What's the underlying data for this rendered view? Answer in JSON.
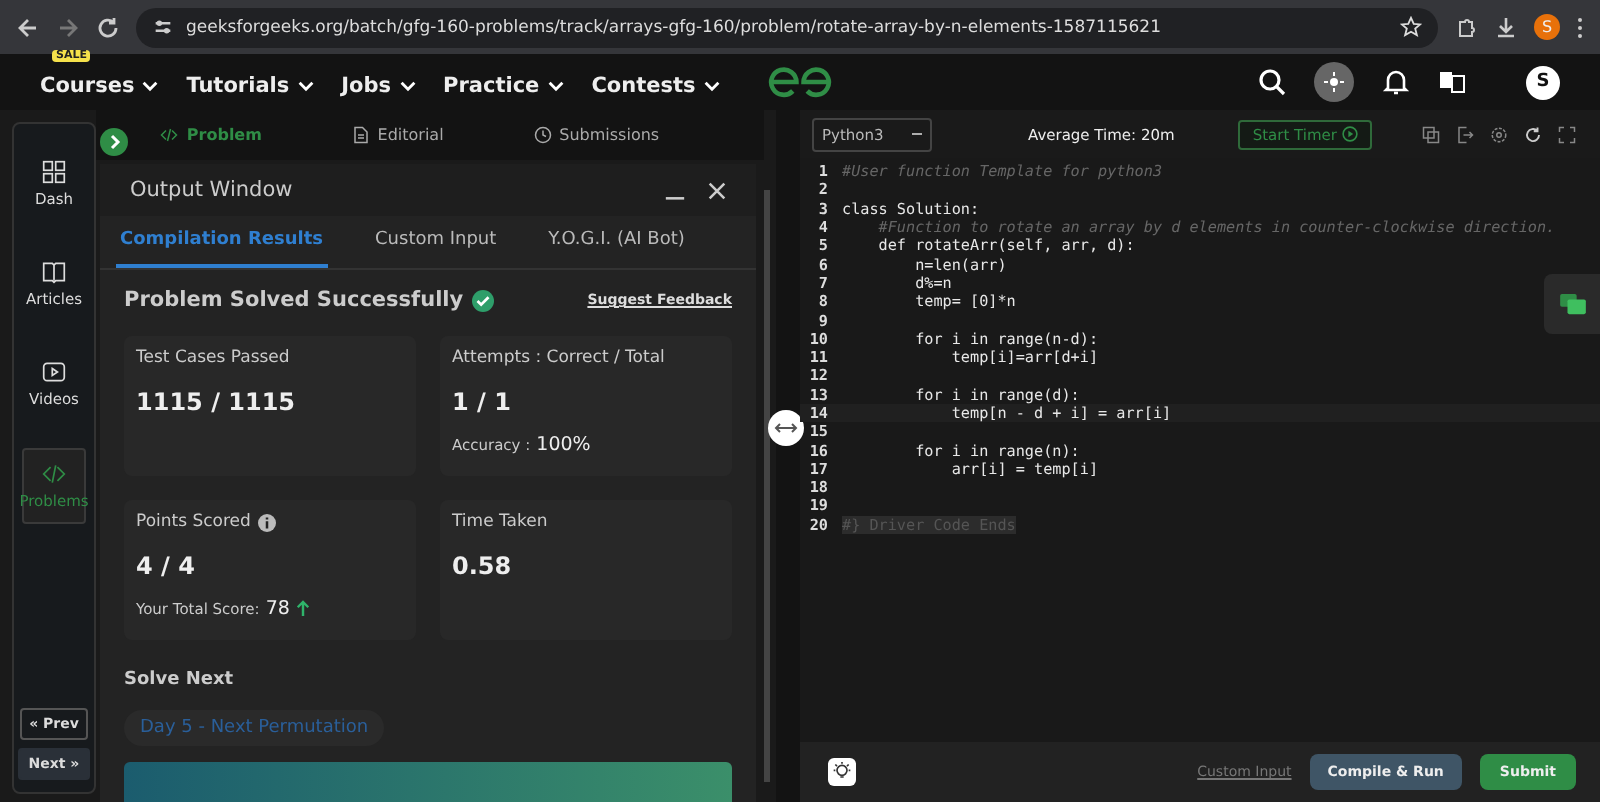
{
  "browser": {
    "url": "geeksforgeeks.org/batch/gfg-160-problems/track/arrays-gfg-160/problem/rotate-array-by-n-elements-1587115621",
    "profile": "S"
  },
  "nav": {
    "items": [
      {
        "label": "Courses",
        "badge": "SALE"
      },
      {
        "label": "Tutorials"
      },
      {
        "label": "Jobs"
      },
      {
        "label": "Practice"
      },
      {
        "label": "Contests"
      }
    ],
    "avatar": "S"
  },
  "sidebar": {
    "items": [
      {
        "label": "Dash",
        "selected": false
      },
      {
        "label": "Articles",
        "selected": false
      },
      {
        "label": "Videos",
        "selected": false
      },
      {
        "label": "Problems",
        "selected": true
      }
    ],
    "prev": "« Prev",
    "next": "Next »"
  },
  "problem_tabs": [
    {
      "label": "Problem",
      "selected": true
    },
    {
      "label": "Editorial",
      "selected": false
    },
    {
      "label": "Submissions",
      "selected": false
    }
  ],
  "output_window": {
    "title": "Output Window",
    "tabs": [
      {
        "label": "Compilation Results",
        "selected": true
      },
      {
        "label": "Custom Input",
        "selected": false
      },
      {
        "label": "Y.O.G.I. (AI Bot)",
        "selected": false
      }
    ],
    "status": "Problem Solved Successfully",
    "feedback": "Suggest Feedback",
    "cards": [
      {
        "label": "Test Cases Passed",
        "value": "1115 / 1115"
      },
      {
        "label": "Attempts : Correct / Total",
        "value": "1 / 1",
        "note_label": "Accuracy :",
        "note_value": "100%"
      },
      {
        "label": "Points Scored",
        "value": "4 / 4",
        "note_label": "Your Total Score:",
        "note_value": "78"
      },
      {
        "label": "Time Taken",
        "value": "0.58"
      }
    ],
    "solve_next": {
      "title": "Solve Next",
      "item": "Day 5 - Next Permutation"
    }
  },
  "editor": {
    "language": "Python3",
    "average_time": "Average Time: 20m",
    "timer": "Start Timer",
    "lines": [
      {
        "n": "1",
        "kind": "comment",
        "text": "#User function Template for python3"
      },
      {
        "n": "2",
        "kind": "code"
      },
      {
        "n": "3",
        "kind": "code",
        "text": "class Solution:"
      },
      {
        "n": "4",
        "kind": "comment",
        "text": "    #Function to rotate an array by d elements in counter-clockwise direction."
      },
      {
        "n": "5",
        "kind": "code",
        "text": "    def rotateArr(self, arr, d):"
      },
      {
        "n": "6",
        "kind": "code",
        "text": "        n=len(arr)"
      },
      {
        "n": "7",
        "kind": "code",
        "text": "        d%=n"
      },
      {
        "n": "8",
        "kind": "code",
        "text": "        temp= [0]*n"
      },
      {
        "n": "9",
        "kind": "code"
      },
      {
        "n": "10",
        "kind": "code",
        "text": "        for i in range(n-d):"
      },
      {
        "n": "11",
        "kind": "code",
        "text": "            temp[i]=arr[d+i]"
      },
      {
        "n": "12",
        "kind": "code"
      },
      {
        "n": "13",
        "kind": "code",
        "text": "        for i in range(d):"
      },
      {
        "n": "14",
        "kind": "current",
        "text": "            temp[n - d + i] = arr[i]"
      },
      {
        "n": "15",
        "kind": "code"
      },
      {
        "n": "16",
        "kind": "code",
        "text": "        for i in range(n):"
      },
      {
        "n": "17",
        "kind": "code",
        "text": "            arr[i] = temp[i]"
      },
      {
        "n": "18",
        "kind": "code"
      },
      {
        "n": "19",
        "kind": "code"
      },
      {
        "n": "20",
        "kind": "folded",
        "text": "#} Driver Code Ends"
      }
    ],
    "custom_input": "Custom Input",
    "compile": "Compile & Run",
    "submit": "Submit"
  }
}
